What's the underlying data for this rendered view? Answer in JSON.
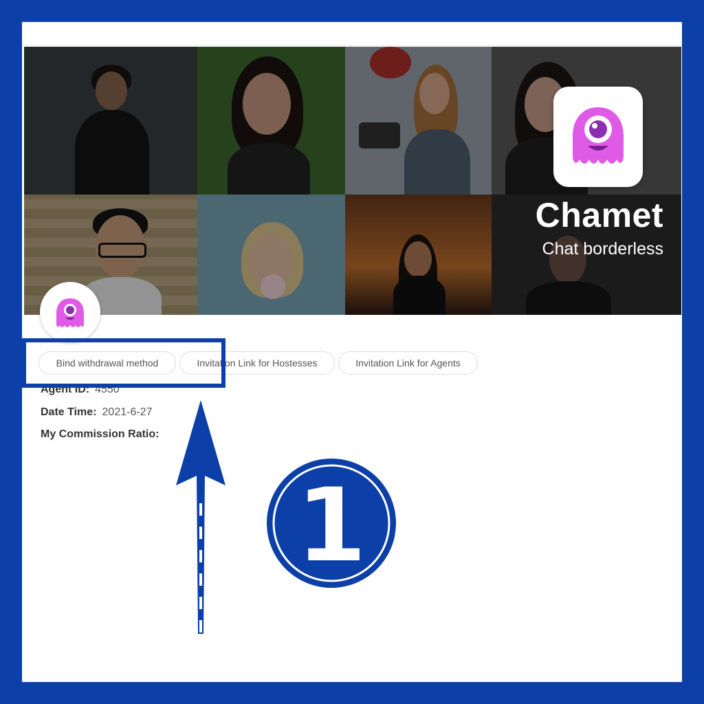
{
  "banner": {
    "brand_name": "Chamet",
    "tagline": "Chat borderless",
    "app_icon": "pink-cyclops-octopus-icon",
    "accent_color": "#e05ae8"
  },
  "profile": {
    "avatar_icon": "pink-cyclops-octopus-icon"
  },
  "actions": {
    "bind_withdrawal": "Bind withdrawal method",
    "invite_hostesses": "Invitation Link for Hostesses",
    "invite_agents": "Invitation Link for Agents"
  },
  "info": {
    "agent_id_label": "Agent ID:",
    "agent_id_value": "4550",
    "date_time_label": "Date Time:",
    "date_time_value": "2021-6-27",
    "commission_label": "My Commission Ratio:",
    "commission_value": ""
  },
  "annotation": {
    "step_number": "1",
    "color": "#0c3fa8"
  }
}
